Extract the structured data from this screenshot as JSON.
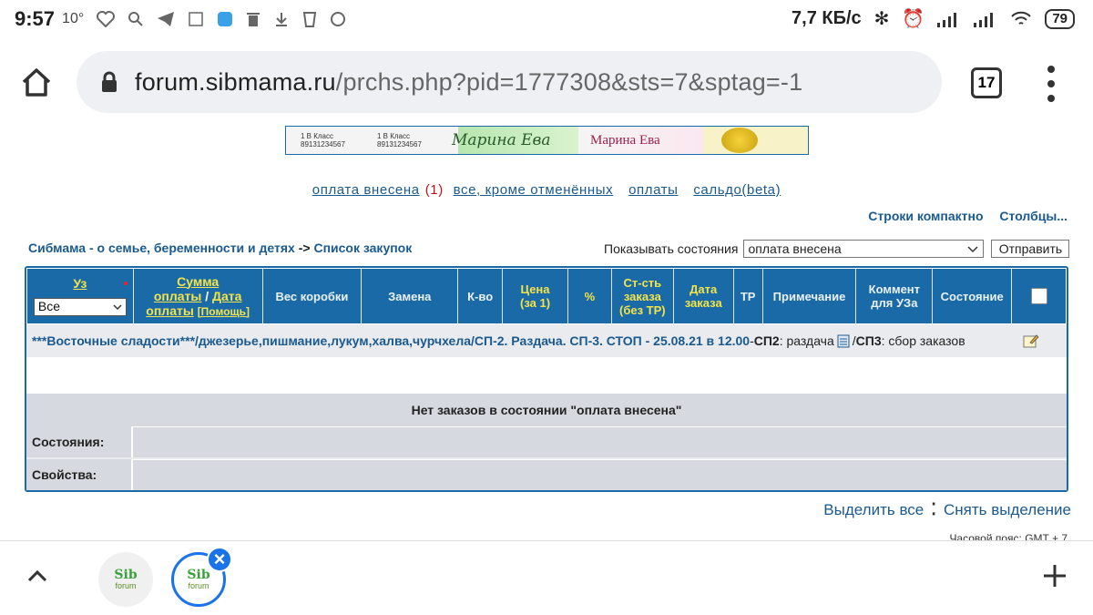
{
  "status": {
    "time": "9:57",
    "temp": "10°",
    "speed": "7,7 КБ/с",
    "battery": "79"
  },
  "browser": {
    "url_host": "forum.sibmama.ru",
    "url_path": "/prchs.php?pid=1777308&sts=7&sptag=-1",
    "tabs_count": "17"
  },
  "banner": {
    "cell1": "1 В Класс 89131234567",
    "cell2": "1 В Класс 89131234567",
    "cell3": "Марина Ева",
    "cell4": "Марина Ева"
  },
  "filters": {
    "paid": "оплата внесена",
    "paid_count": "(1)",
    "all_except_cancelled": "все, кроме отменённых",
    "payments": "оплаты",
    "balance": "сальдо(beta)"
  },
  "view": {
    "compact_rows": "Строки компактно",
    "columns": "Столбцы..."
  },
  "breadcrumb": {
    "home": "Сибмама - о семье, беременности и детях",
    "sep": "->",
    "current": "Список закупок"
  },
  "state_filter": {
    "label": "Показывать состояния",
    "selected": "оплата внесена",
    "submit": "Отправить"
  },
  "table": {
    "headers": {
      "uz": "Уз",
      "uz_select": "Все",
      "sum_line1": "Сумма",
      "sum_line2a": "оплаты",
      "sum_slash": "/",
      "sum_line2b": "Дата",
      "sum_line3": "оплаты",
      "sum_help": "[Помощь]",
      "box_weight": "Вес коробки",
      "replacement": "Замена",
      "qty": "К-во",
      "price_line1": "Цена",
      "price_line2": "(за 1)",
      "pct": "%",
      "total_line1": "Ст-сть",
      "total_line2": "заказа",
      "total_line3": "(без ТР)",
      "date_line1": "Дата",
      "date_line2": "заказа",
      "tr": "ТР",
      "note": "Примечание",
      "comment_line1": "Коммент",
      "comment_line2": "для УЗа",
      "state": "Состояние"
    },
    "purchase": {
      "title": "***Восточные сладости***/джезерье,пишмание,лукум,халва,чурчхела/СП-2. Раздача. СП-3. СТОП - 25.08.21 в 12.00",
      "dash": " - ",
      "sp2_label": "СП2",
      "sp2_value": ": раздача",
      "slash": " / ",
      "sp3_label": "СП3",
      "sp3_value": ": сбор заказов"
    },
    "empty_message": "Нет заказов в состоянии \"оплата внесена\"",
    "states_label": "Состояния:",
    "props_label": "Свойства:"
  },
  "selection": {
    "select_all": "Выделить все",
    "deselect": "Снять выделение"
  },
  "timezone": "Часовой пояс: GMT + 7",
  "bottom": {
    "tab1_top": "Sib",
    "tab1_bottom": "forum",
    "tab2_top": "Sib",
    "tab2_bottom": "forum"
  }
}
